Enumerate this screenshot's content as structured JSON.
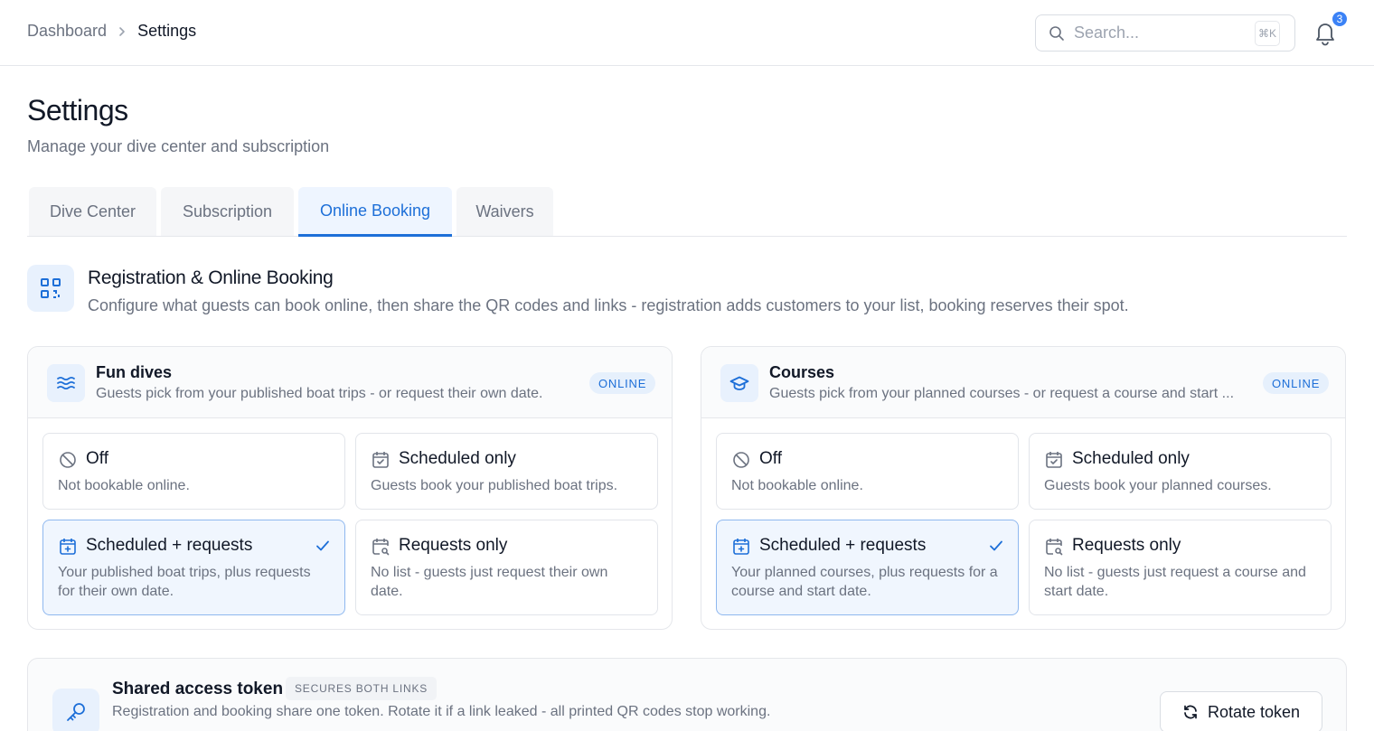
{
  "breadcrumb": {
    "parent": "Dashboard",
    "current": "Settings"
  },
  "search": {
    "placeholder": "Search...",
    "shortcut": "⌘K"
  },
  "notifications": {
    "count": "3"
  },
  "page": {
    "title": "Settings",
    "subtitle": "Manage your dive center and subscription"
  },
  "tabs": [
    {
      "label": "Dive Center",
      "active": false
    },
    {
      "label": "Subscription",
      "active": false
    },
    {
      "label": "Online Booking",
      "active": true
    },
    {
      "label": "Waivers",
      "active": false
    }
  ],
  "section": {
    "title": "Registration & Online Booking",
    "subtitle": "Configure what guests can book online, then share the QR codes and links - registration adds customers to your list, booking reserves their spot."
  },
  "cards": [
    {
      "title": "Fun dives",
      "subtitle": "Guests pick from your published boat trips - or request their own date.",
      "status": "ONLINE",
      "icon": "waves-icon",
      "options": [
        {
          "title": "Off",
          "desc": "Not bookable online.",
          "icon": "off-icon",
          "selected": false
        },
        {
          "title": "Scheduled only",
          "desc": "Guests book your published boat trips.",
          "icon": "calendar-check-icon",
          "selected": false
        },
        {
          "title": "Scheduled + requests",
          "desc": "Your published boat trips, plus requests for their own date.",
          "icon": "calendar-plus-icon",
          "selected": true
        },
        {
          "title": "Requests only",
          "desc": "No list - guests just request their own date.",
          "icon": "calendar-search-icon",
          "selected": false
        }
      ]
    },
    {
      "title": "Courses",
      "subtitle": "Guests pick from your planned courses - or request a course and start ...",
      "status": "ONLINE",
      "icon": "graduation-cap-icon",
      "options": [
        {
          "title": "Off",
          "desc": "Not bookable online.",
          "icon": "off-icon",
          "selected": false
        },
        {
          "title": "Scheduled only",
          "desc": "Guests book your planned courses.",
          "icon": "calendar-check-icon",
          "selected": false
        },
        {
          "title": "Scheduled + requests",
          "desc": "Your planned courses, plus requests for a course and start date.",
          "icon": "calendar-plus-icon",
          "selected": true
        },
        {
          "title": "Requests only",
          "desc": "No list - guests just request a course and start date.",
          "icon": "calendar-search-icon",
          "selected": false
        }
      ]
    }
  ],
  "token": {
    "title": "Shared access token",
    "badge": "SECURES BOTH LINKS",
    "subtitle": "Registration and booking share one token. Rotate it if a link leaked - all printed QR codes stop working.",
    "button": "Rotate token"
  },
  "colors": {
    "accent": "#1d6fd8",
    "accent_bg": "#e8f1fd",
    "selected_border": "#8fb8ef"
  }
}
